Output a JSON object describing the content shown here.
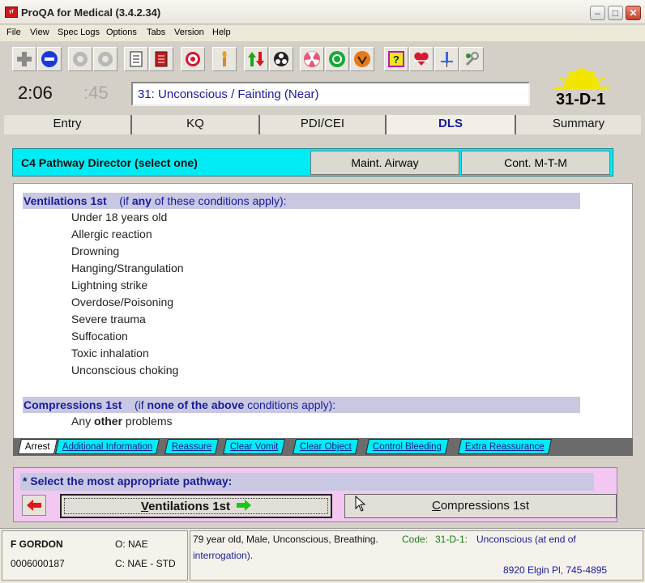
{
  "window": {
    "title": "ProQA for Medical (3.4.2.34)",
    "icon_text": "ᵞᶠ"
  },
  "menu": [
    "File",
    "View",
    "Spec Logs",
    "Options",
    "Tabs",
    "Version",
    "Help"
  ],
  "toolbar": {
    "icons": [
      "plus-icon",
      "no-entry-icon",
      "disabled-circle-icon",
      "disabled-circle-icon",
      "document-icon",
      "red-document-icon",
      "target-icon",
      "candle-icon",
      "updown-arrows-icon",
      "biohazard-icon",
      "radiation-icon",
      "recycle-icon",
      "orange-symbol-icon",
      "question-icon",
      "heart-icon",
      "syringe-icon",
      "wrench-icon"
    ]
  },
  "header": {
    "time": "2:06",
    "seconds": ":45",
    "complaint": "31:  Unconscious / Fainting (Near)",
    "determinant": "31-D-1",
    "sun_color": "#f2e600"
  },
  "tabs": [
    {
      "label": "Entry",
      "active": false
    },
    {
      "label": "KQ",
      "active": false
    },
    {
      "label": "PDI/CEI",
      "active": false
    },
    {
      "label": "DLS",
      "active": true
    },
    {
      "label": "Summary",
      "active": false
    }
  ],
  "director": {
    "title": "C4 Pathway Director (select one)",
    "buttons": [
      "Maint. Airway",
      "Cont. M-T-M"
    ],
    "color": "#00ecf5"
  },
  "ventilations": {
    "head_bold": "Ventilations 1st",
    "head_pre": "(if ",
    "head_emph": "any",
    "head_post": " of these conditions apply):",
    "conditions": [
      "Under 18 years old",
      "Allergic reaction",
      "Drowning",
      "Hanging/Strangulation",
      "Lightning strike",
      "Overdose/Poisoning",
      "Severe trauma",
      "Suffocation",
      "Toxic inhalation",
      "Unconscious choking"
    ]
  },
  "compressions": {
    "head_bold": "Compressions 1st",
    "head_pre": "(if ",
    "head_emph": "none of the above",
    "head_post": " conditions apply):",
    "item_pre": "Any ",
    "item_emph": "other",
    "item_post": " problems"
  },
  "bottom_tabs": [
    "Arrest",
    "Additional Information",
    "Reassure",
    "Clear Vomit",
    "Clear Object",
    "Control Bleeding",
    "Extra Reassurance"
  ],
  "select": {
    "prompt": "* Select the most appropriate pathway:",
    "vent_btn_u": "V",
    "vent_btn_rest": "entilations 1st",
    "comp_btn_u": "C",
    "comp_btn_rest": "ompressions 1st"
  },
  "status": {
    "name": "F GORDON",
    "id": "0006000187",
    "o_code": "O: NAE",
    "c_code": "C: NAE - STD",
    "summary": "79 year old, Male, Unconscious, Breathing.",
    "code_label": "Code:",
    "code_value": "31-D-1:",
    "code_desc1": "Unconscious (at end of",
    "code_desc2": "interrogation).",
    "address": "8920 Elgin Pl,  745-4895"
  }
}
